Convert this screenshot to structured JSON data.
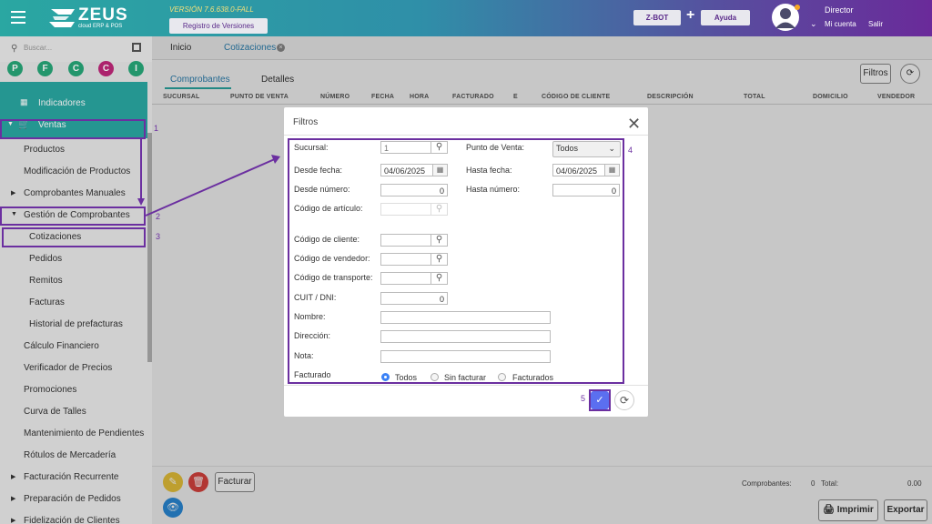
{
  "header": {
    "brand": "ZEUS",
    "brand_sub": "cloud ERP & POS",
    "version": "VERSIÓN 7.6.638.0-FALL",
    "registro": "Registro de Versiones",
    "zbot": "Z-BOT",
    "plus": "+",
    "ayuda": "Ayuda",
    "user": "Director",
    "my_account": "Mi cuenta",
    "logout": "Salir"
  },
  "sidebar": {
    "search_placeholder": "Buscar...",
    "circles": [
      "P",
      "F",
      "C",
      "C",
      "I"
    ],
    "circle_colors": [
      "#27a879",
      "#27a879",
      "#27a879",
      "#c0287a",
      "#27a879"
    ],
    "indicadores": "Indicadores",
    "ventas": "Ventas",
    "items": [
      "Productos",
      "Modificación de Productos",
      "Comprobantes Manuales",
      "Gestión de Comprobantes",
      "Cotizaciones",
      "Pedidos",
      "Remitos",
      "Facturas",
      "Historial de prefacturas",
      "Cálculo Financiero",
      "Verificador de Precios",
      "Promociones",
      "Curva de Talles",
      "Mantenimiento de Pendientes",
      "Rótulos de Mercadería",
      "Facturación Recurrente",
      "Preparación de Pedidos",
      "Fidelización de Clientes"
    ]
  },
  "tabs": {
    "inicio": "Inicio",
    "cotizaciones": "Cotizaciones"
  },
  "subtabs": {
    "comprobantes": "Comprobantes",
    "detalles": "Detalles"
  },
  "toolbar": {
    "filtros": "Filtros"
  },
  "table": {
    "columns": [
      "SUCURSAL",
      "PUNTO DE VENTA",
      "NÚMERO",
      "FECHA",
      "HORA",
      "FACTURADO",
      "E",
      "CÓDIGO DE CLIENTE",
      "DESCRIPCIÓN",
      "TOTAL",
      "DOMICILIO",
      "VENDEDOR"
    ]
  },
  "modal": {
    "title": "Filtros",
    "sucursal_label": "Sucursal:",
    "sucursal_value": "1",
    "punto_venta_label": "Punto de Venta:",
    "punto_venta_value": "Todos",
    "desde_fecha_label": "Desde fecha:",
    "desde_fecha_value": "04/06/2025",
    "hasta_fecha_label": "Hasta fecha:",
    "hasta_fecha_value": "04/06/2025",
    "desde_numero_label": "Desde número:",
    "desde_numero_value": "0",
    "hasta_numero_label": "Hasta número:",
    "hasta_numero_value": "0",
    "codigo_articulo_label": "Código de artículo:",
    "codigo_cliente_label": "Código de cliente:",
    "codigo_vendedor_label": "Código de vendedor:",
    "codigo_transporte_label": "Código de transporte:",
    "cuit_label": "CUIT / DNI:",
    "cuit_value": "0",
    "nombre_label": "Nombre:",
    "direccion_label": "Dirección:",
    "nota_label": "Nota:",
    "facturado_label": "Facturado",
    "radio_todos": "Todos",
    "radio_sin_facturar": "Sin facturar",
    "radio_facturados": "Facturados"
  },
  "annotations": [
    "1",
    "2",
    "3",
    "4",
    "5"
  ],
  "bottom": {
    "facturar": "Facturar",
    "comprobantes_label": "Comprobantes:",
    "comprobantes_count": "0",
    "total_label": "Total:",
    "total_value": "0.00",
    "imprimir": "Imprimir",
    "exportar": "Exportar"
  }
}
